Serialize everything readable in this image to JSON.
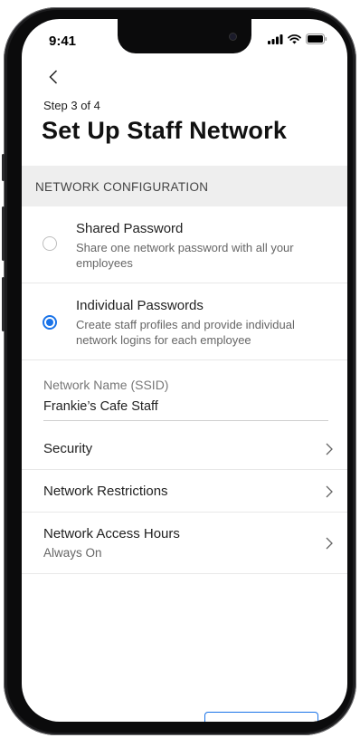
{
  "status_bar": {
    "time": "9:41"
  },
  "nav": {
    "back_icon": "chevron-left-icon"
  },
  "header": {
    "step": "Step 3 of 4",
    "title": "Set Up Staff Network"
  },
  "section": {
    "label": "NETWORK CONFIGURATION"
  },
  "options": [
    {
      "title": "Shared Password",
      "description": "Share one network password with all your employees",
      "selected": false
    },
    {
      "title": "Individual Passwords",
      "description": "Create staff profiles and provide individual network logins for each employee",
      "selected": true
    }
  ],
  "network_name": {
    "label": "Network Name (SSID)",
    "value": "Frankie’s Cafe Staff"
  },
  "settings": [
    {
      "label": "Security",
      "sub": ""
    },
    {
      "label": "Network Restrictions",
      "sub": ""
    },
    {
      "label": "Network Access Hours",
      "sub": "Always On"
    }
  ],
  "colors": {
    "accent": "#1a73e8",
    "section_bg": "#eeeeee"
  }
}
